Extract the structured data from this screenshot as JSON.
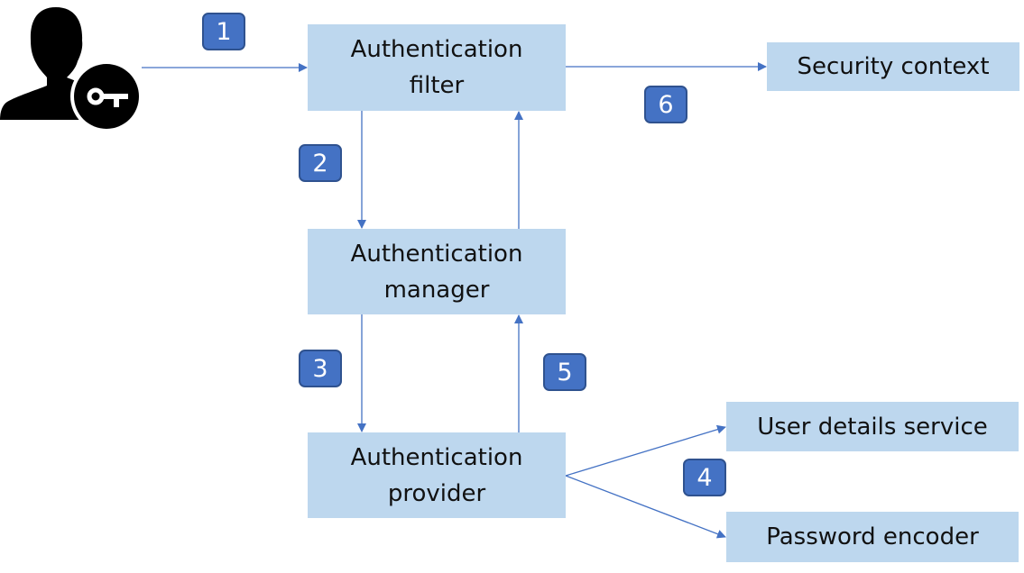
{
  "diagram": {
    "actor": {
      "icon": "user-key-icon",
      "label": "User with key"
    },
    "nodes": {
      "auth_filter": "Authentication\nfilter",
      "security_context": "Security context",
      "auth_manager": "Authentication\nmanager",
      "auth_provider": "Authentication\nprovider",
      "user_details_service": "User details service",
      "password_encoder": "Password encoder"
    },
    "steps": [
      "1",
      "2",
      "3",
      "4",
      "5",
      "6"
    ],
    "colors": {
      "node_fill": "#BDD7EE",
      "badge_fill": "#4472C4",
      "badge_border": "#2F528F",
      "arrow": "#4472C4"
    },
    "edges": [
      {
        "from": "actor",
        "to": "auth_filter",
        "step": "1"
      },
      {
        "from": "auth_filter",
        "to": "auth_manager",
        "step": "2"
      },
      {
        "from": "auth_manager",
        "to": "auth_provider",
        "step": "3"
      },
      {
        "from": "auth_provider",
        "to": "user_details_service",
        "step": "4"
      },
      {
        "from": "auth_provider",
        "to": "password_encoder",
        "step": "4"
      },
      {
        "from": "auth_provider",
        "to": "auth_manager",
        "step": "5"
      },
      {
        "from": "auth_manager",
        "to": "auth_filter",
        "step": "5"
      },
      {
        "from": "auth_filter",
        "to": "security_context",
        "step": "6"
      }
    ]
  }
}
